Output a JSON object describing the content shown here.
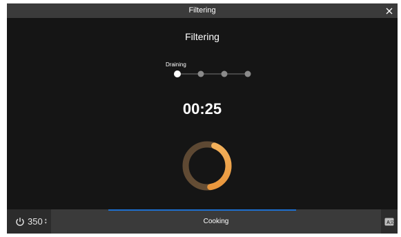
{
  "window": {
    "title": "Filtering",
    "close_icon": "close-icon"
  },
  "main": {
    "heading": "Filtering",
    "steps": {
      "current_label": "Draining",
      "count": 4,
      "active_index": 0
    },
    "timer": "00:25",
    "ring_progress": 0.42
  },
  "bottom_bar": {
    "power_icon": "power-icon",
    "temperature": "350",
    "status": "Cooking",
    "progress_fraction": 0.48,
    "corner_icon": "language-icon"
  },
  "colors": {
    "background": "#151515",
    "titlebar": "#3b3b3b",
    "bottombar": "#3a3a3a",
    "ring_accent": "#f0a347",
    "progress": "#1e6fcf",
    "step_inactive": "#8a8a8a"
  }
}
